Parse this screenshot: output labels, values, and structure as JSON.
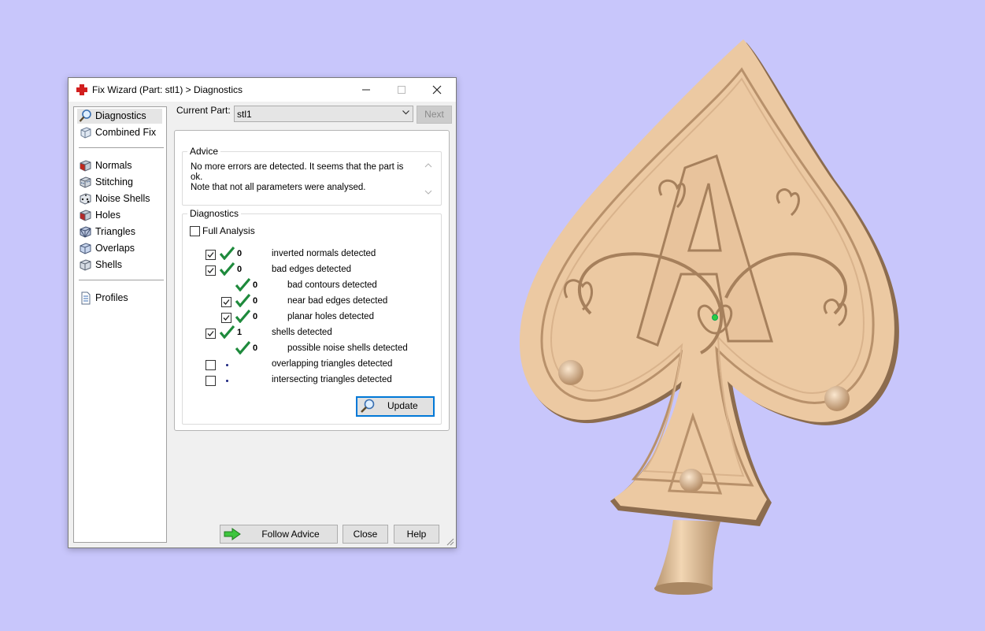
{
  "window": {
    "title": "Fix Wizard (Part: stl1) > Diagnostics"
  },
  "sidebar": {
    "items": [
      {
        "label": "Diagnostics",
        "icon": "magnifier-icon",
        "selected": true
      },
      {
        "label": "Combined Fix",
        "icon": "cube-icon"
      }
    ],
    "fixes": [
      {
        "label": "Normals",
        "icon": "red-cube-icon"
      },
      {
        "label": "Stitching",
        "icon": "stitching-cube-icon"
      },
      {
        "label": "Noise Shells",
        "icon": "dice-icon"
      },
      {
        "label": "Holes",
        "icon": "holes-cube-icon"
      },
      {
        "label": "Triangles",
        "icon": "triangles-cube-icon"
      },
      {
        "label": "Overlaps",
        "icon": "overlaps-cube-icon"
      },
      {
        "label": "Shells",
        "icon": "shells-cube-icon"
      }
    ],
    "profiles": {
      "label": "Profiles",
      "icon": "document-icon"
    }
  },
  "toolbar": {
    "current_part_label": "Current Part:",
    "current_part_value": "stl1",
    "next_label": "Next"
  },
  "advice": {
    "title": "Advice",
    "text_line1": "No more errors are detected. It seems that the part is ok.",
    "text_line2": "Note that not all parameters were analysed."
  },
  "diagnostics": {
    "title": "Diagnostics",
    "full_analysis_label": "Full Analysis",
    "full_analysis_checked": false,
    "rows": [
      {
        "checked": true,
        "ok": true,
        "count": "0",
        "label": "inverted normals detected"
      },
      {
        "checked": true,
        "ok": true,
        "count": "0",
        "label": "bad edges detected"
      },
      {
        "checked": null,
        "ok": true,
        "count": "0",
        "label": "bad contours detected"
      },
      {
        "checked": true,
        "ok": true,
        "count": "0",
        "label": "near bad edges detected"
      },
      {
        "checked": true,
        "ok": true,
        "count": "0",
        "label": "planar holes detected"
      },
      {
        "checked": true,
        "ok": true,
        "count": "1",
        "label": "shells detected"
      },
      {
        "checked": null,
        "ok": true,
        "count": "0",
        "label": "possible noise shells detected"
      },
      {
        "checked": false,
        "ok": false,
        "count": "",
        "label": "overlapping triangles detected"
      },
      {
        "checked": false,
        "ok": false,
        "count": "",
        "label": "intersecting triangles detected"
      }
    ],
    "update_label": "Update"
  },
  "footer": {
    "follow_advice_label": "Follow Advice",
    "close_label": "Close",
    "help_label": "Help"
  },
  "colors": {
    "background": "#c8c6fb",
    "model": "#ecc9a2",
    "check_green": "#1e8a3c",
    "focus_blue": "#0078d7"
  }
}
